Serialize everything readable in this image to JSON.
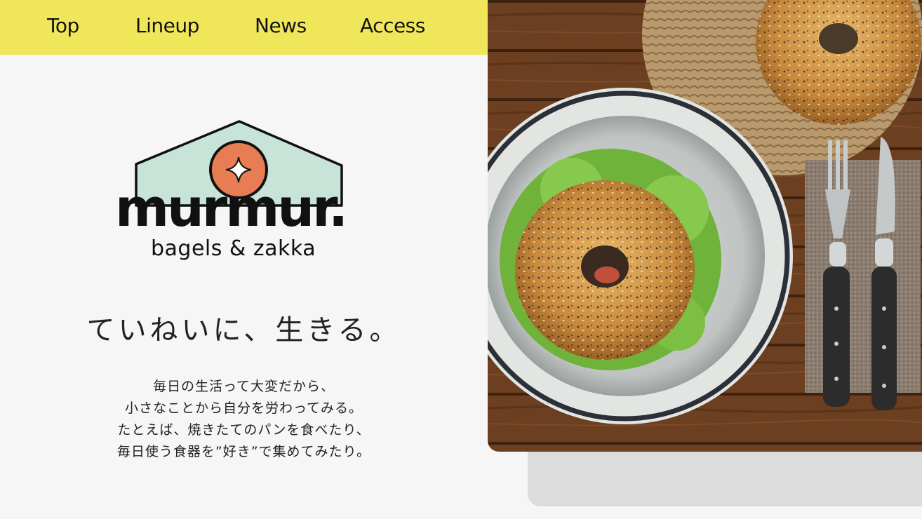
{
  "nav": {
    "items": [
      {
        "label": "Top"
      },
      {
        "label": "Lineup"
      },
      {
        "label": "News"
      },
      {
        "label": "Access"
      }
    ]
  },
  "brand": {
    "name": "murmur.",
    "subtitle": "bagels & zakka",
    "logo_icon": "house-with-star-icon"
  },
  "hero": {
    "tagline": "ていねいに、生きる。",
    "lines": [
      "毎日の生活って大変だから、",
      "小さなことから自分を労わってみる。",
      "たとえば、焼きたてのパンを食べたり、",
      "毎日使う食器を”好き”で集めてみたり。"
    ],
    "image_icon": "bagel-plate-photo"
  },
  "colors": {
    "nav_bg": "#f0e65a",
    "page_bg": "#f6f6f6",
    "logo_house": "#c8e4d8",
    "logo_circle": "#e87c52"
  }
}
